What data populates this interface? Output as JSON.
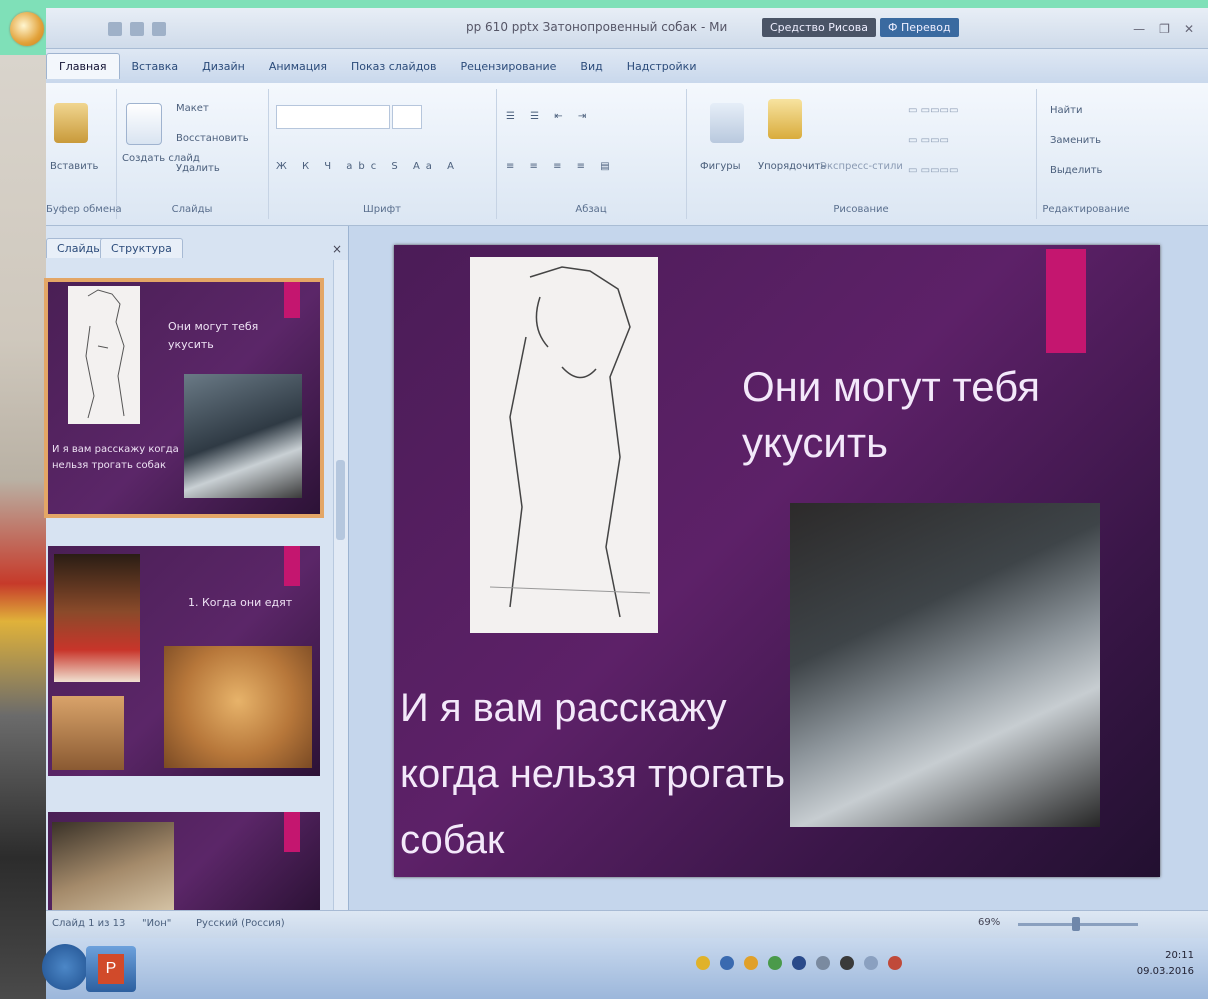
{
  "window": {
    "title": "pp 610 pptx Затонопровенный собак - Mи",
    "title_pills": [
      "Средство Рисова",
      "Ф Перевод"
    ]
  },
  "ribbon_tabs": [
    "Главная",
    "Вставка",
    "Дизайн",
    "Анимация",
    "Показ слайдов",
    "Рецензирование",
    "Вид",
    "Надстройки"
  ],
  "ribbon_groups": [
    "Буфер обмена",
    "Слайды",
    "Шрифт",
    "Абзац",
    "Рисование",
    "Редактирование"
  ],
  "ribbon_buttons": {
    "paste": "Вставить",
    "create": "Создать слайд",
    "layout": "Макет",
    "reset": "Восстановить",
    "delete": "Удалить",
    "shapes": "Фигуры",
    "arrange": "Упорядочить",
    "quick_styles": "Экспресс-стили",
    "find": "Найти",
    "replace": "Заменить",
    "select": "Выделить"
  },
  "panel": {
    "tab1": "Слайды",
    "tab2": "Структура",
    "close": "×"
  },
  "thumbnails": [
    {
      "title": "Они могут тебя укусить",
      "body": "И я вам расскажу когда нельзя трогать собак",
      "selected": true
    },
    {
      "title": "1. Когда они едят",
      "body": ""
    },
    {
      "title": "",
      "body": ""
    }
  ],
  "slide": {
    "title_line1": "Они могут тебя",
    "title_line2": "укусить",
    "body_line1": "И я вам расскажу",
    "body_line2": "когда нельзя трогать",
    "body_line3": "собак"
  },
  "status": {
    "slide_info": "Слайд 1 из 13",
    "theme": "\"Ион\"",
    "language": "Русский (Россия)",
    "zoom": "69%"
  },
  "clock": {
    "time": "20:11",
    "date": "09.03.2016"
  },
  "colors": {
    "slide_bg": "#4b1c57",
    "accent": "#c4166f",
    "selection": "#e3a666"
  }
}
